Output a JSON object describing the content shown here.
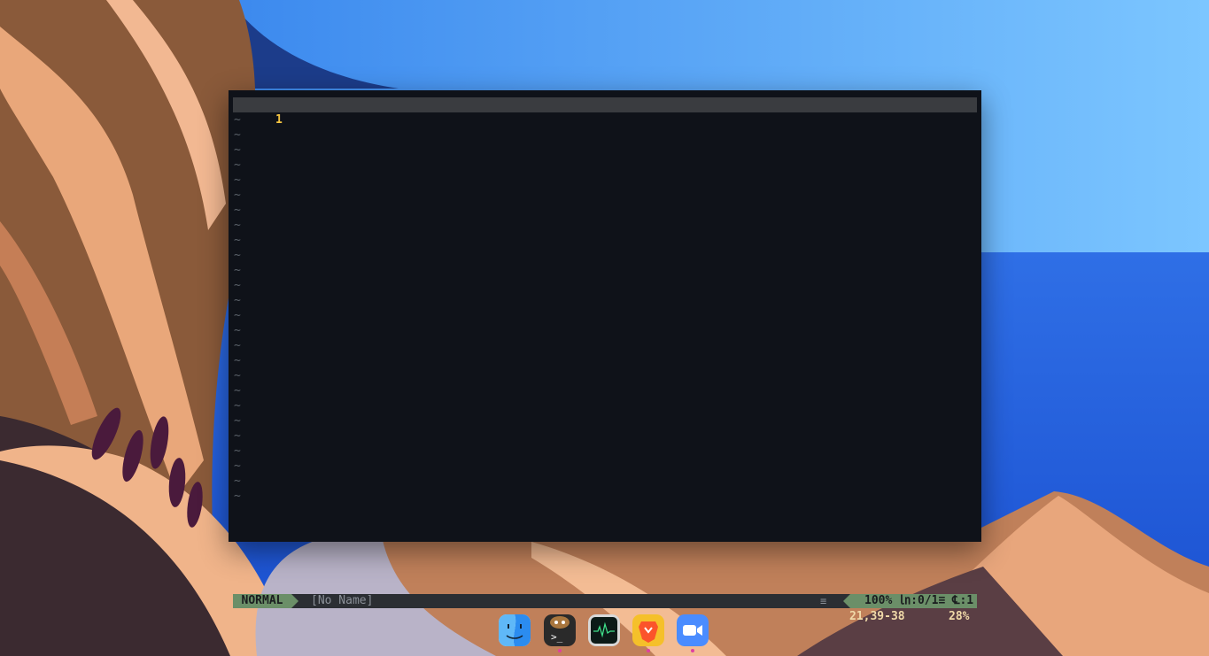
{
  "editor": {
    "current_line_number": "1",
    "empty_line_marker": "~",
    "empty_line_count": 26,
    "statusline": {
      "mode": "NORMAL",
      "filename": "[No Name]",
      "filetype_icon": "≡",
      "right_info": "100% ㏑:0/1≡ ℄:1"
    },
    "cmdline": {
      "cursor_position": "21,39-38",
      "scroll_percent": "28%"
    }
  },
  "dock": {
    "items": [
      {
        "name": "finder",
        "icon": "finder-icon"
      },
      {
        "name": "terminal",
        "icon": "terminal-icon",
        "glyph": ">_"
      },
      {
        "name": "activity-monitor",
        "icon": "activity-monitor-icon"
      },
      {
        "name": "brave-browser",
        "icon": "brave-lion-icon"
      },
      {
        "name": "zoom",
        "icon": "zoom-camera-icon"
      }
    ]
  },
  "colors": {
    "mode_bg": "#6b8f68",
    "line_number": "#f5c542",
    "editor_bg": "#0f1219",
    "cmdline_text": "#f0d9a8"
  }
}
